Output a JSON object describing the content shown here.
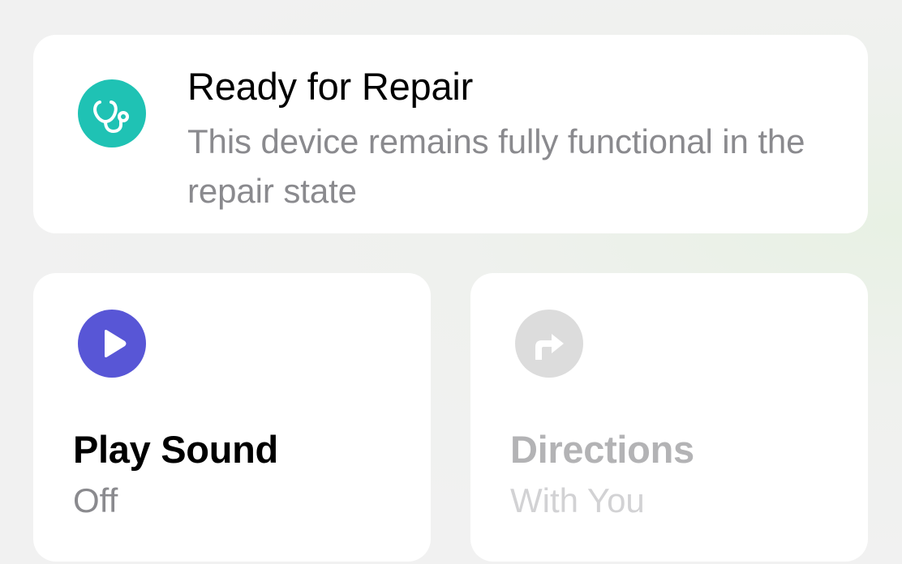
{
  "colors": {
    "repair_accent": "#1fc2b4",
    "sound_accent": "#5856d6",
    "disabled_icon_bg": "#dcdcdc",
    "disabled_text": "#c6c6c8",
    "secondary_text": "#8a8a8e",
    "primary_text": "#000000"
  },
  "repair": {
    "icon": "stethoscope-icon",
    "title": "Ready for Repair",
    "subtitle": "This device remains fully functional in the repair state"
  },
  "play_sound": {
    "icon": "play-icon",
    "title": "Play Sound",
    "status": "Off",
    "enabled": true
  },
  "directions": {
    "icon": "turn-right-arrow-icon",
    "title": "Directions",
    "status": "With You",
    "enabled": false
  }
}
